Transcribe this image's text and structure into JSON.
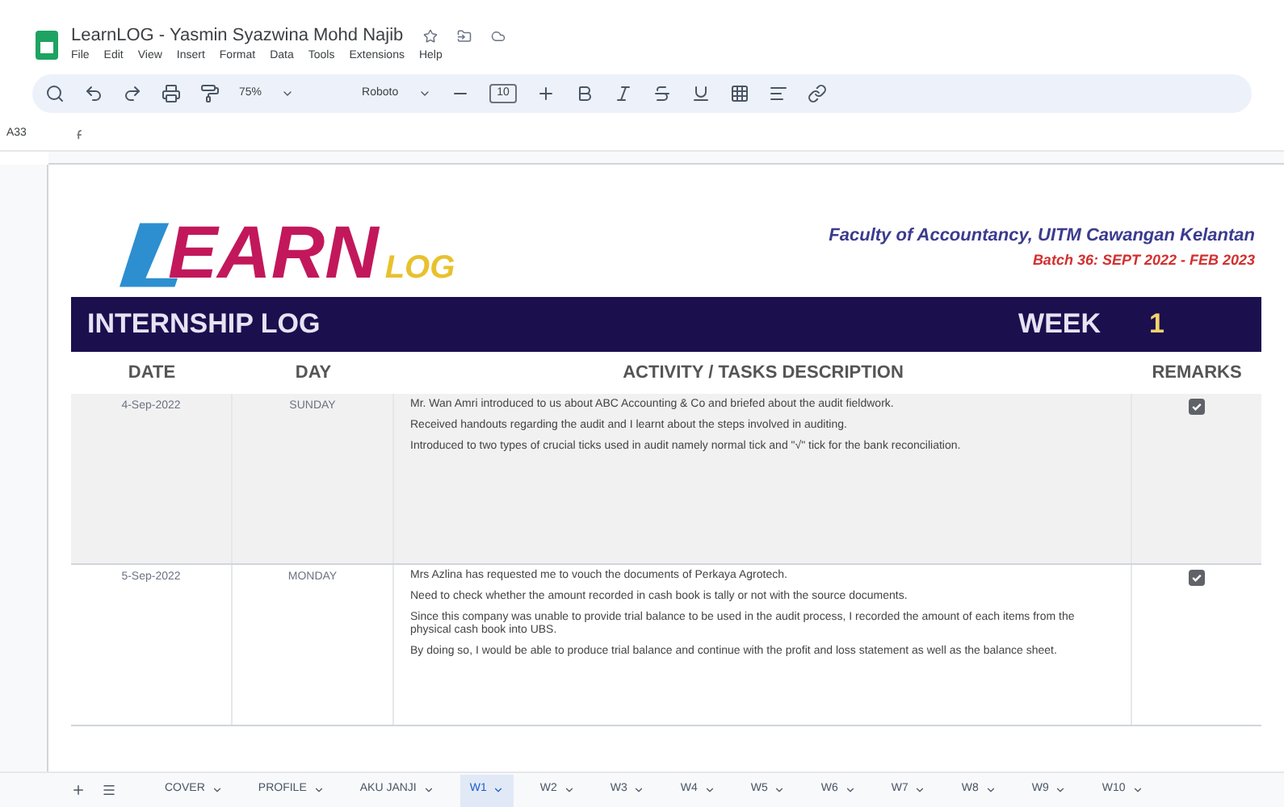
{
  "doc": {
    "title": "LearnLOG - Yasmin Syazwina Mohd Najib",
    "menu": [
      "File",
      "Edit",
      "View",
      "Insert",
      "Format",
      "Data",
      "Tools",
      "Extensions",
      "Help"
    ]
  },
  "toolbar": {
    "zoom": "75%",
    "font": "Roboto",
    "font_size": "10"
  },
  "formula_bar": {
    "cell": "A33"
  },
  "sheet": {
    "logo_main": "EARN",
    "logo_sub": "LOG",
    "faculty": "Faculty of Accountancy, UITM Cawangan Kelantan",
    "batch": "Batch 36: SEPT 2022 - FEB 2023",
    "banner_title": "INTERNSHIP LOG",
    "week_label": "WEEK",
    "week_number": "1",
    "columns": [
      "DATE",
      "DAY",
      "ACTIVITY / TASKS DESCRIPTION",
      "REMARKS"
    ],
    "rows": [
      {
        "date": "4-Sep-2022",
        "day": "SUNDAY",
        "checked": true,
        "activities": [
          "Mr. Wan Amri introduced to us about ABC Accounting & Co and briefed about the audit fieldwork.",
          "Received handouts regarding the audit and I learnt about the steps involved in auditing.",
          "Introduced to two types of crucial ticks used in audit namely normal tick and \"√\" tick for the bank reconciliation."
        ]
      },
      {
        "date": "5-Sep-2022",
        "day": "MONDAY",
        "checked": true,
        "activities": [
          "Mrs Azlina has requested me to vouch the documents of Perkaya Agrotech.",
          "Need to check whether the amount recorded in cash book is tally or not with the source documents.",
          "Since this company was unable to provide trial balance to be used in the audit process, I recorded the amount of each items from the physical cash book into UBS.",
          "By doing so, I would be able to produce trial balance and continue with the profit and loss statement as well as the balance sheet."
        ]
      }
    ]
  },
  "tabs": [
    {
      "label": "COVER",
      "selected": false
    },
    {
      "label": "PROFILE",
      "selected": false
    },
    {
      "label": "AKU JANJI",
      "selected": false
    },
    {
      "label": "W1",
      "selected": true
    },
    {
      "label": "W2",
      "selected": false
    },
    {
      "label": "W3",
      "selected": false
    },
    {
      "label": "W4",
      "selected": false
    },
    {
      "label": "W5",
      "selected": false
    },
    {
      "label": "W6",
      "selected": false
    },
    {
      "label": "W7",
      "selected": false
    },
    {
      "label": "W8",
      "selected": false
    },
    {
      "label": "W9",
      "selected": false
    },
    {
      "label": "W10",
      "selected": false
    }
  ]
}
